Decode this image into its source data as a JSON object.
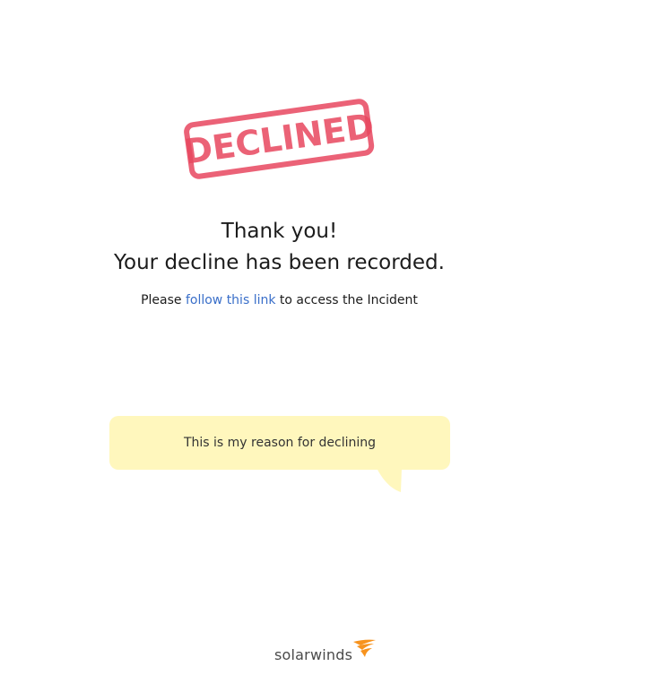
{
  "stamp": {
    "text": "DECLINED",
    "color": "#e8475f"
  },
  "confirmation": {
    "line1": "Thank you!",
    "line2": "Your decline has been recorded."
  },
  "access": {
    "prefix": "Please ",
    "link_text": "follow this link",
    "suffix": " to access the Incident"
  },
  "reason": {
    "text": "This is my reason for declining",
    "bubble_color": "#fff7bd"
  },
  "branding": {
    "logo_text": "solarwinds",
    "logo_icon": "solarwinds-flame-icon",
    "logo_accent_color": "#f7931e"
  }
}
